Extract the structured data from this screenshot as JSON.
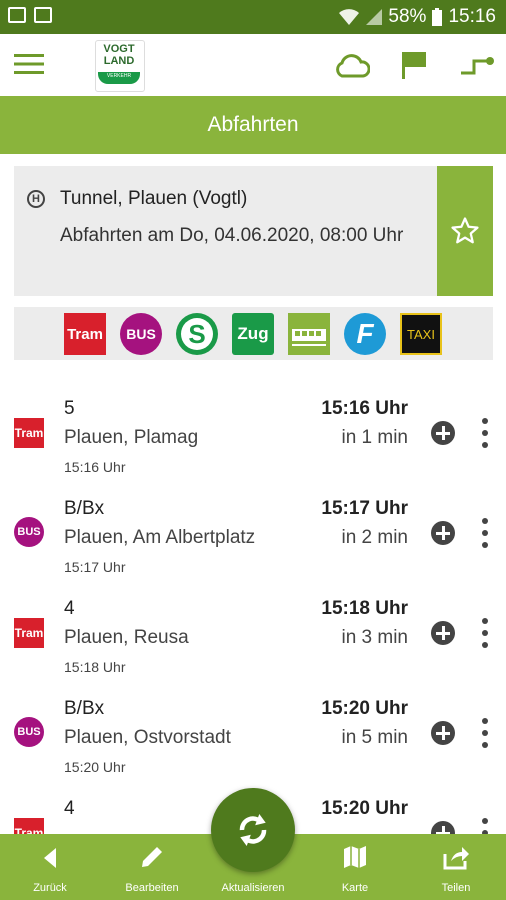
{
  "status_bar": {
    "battery": "58%",
    "time": "15:16"
  },
  "toolbar": {
    "logo_text_line1": "VOGT",
    "logo_text_line2": "LAND",
    "logo_text_line3": "VERKEHR"
  },
  "title": "Abfahrten",
  "station": {
    "name": "Tunnel, Plauen (Vogtl)",
    "departures_at": "Abfahrten am Do, 04.06.2020, 08:00 Uhr",
    "stop_icon_label": "H"
  },
  "modes": [
    {
      "name": "tram",
      "label": "Tram",
      "color": "#d8202c"
    },
    {
      "name": "bus",
      "label": "BUS",
      "color": "#a5127f"
    },
    {
      "name": "sbahn",
      "label": "S",
      "color": "#1a9a48"
    },
    {
      "name": "zug",
      "label": "Zug",
      "color": "#1a9a48"
    },
    {
      "name": "railcar",
      "label": "",
      "color": "#8ab43c"
    },
    {
      "name": "ferry",
      "label": "F",
      "color": "#1e9ad6"
    },
    {
      "name": "taxi",
      "label": "TAXI",
      "color": "#111111"
    }
  ],
  "departures": [
    {
      "mode": "Tram",
      "line": "5",
      "destination": "Plauen, Plamag",
      "scheduled": "15:16 Uhr",
      "time": "15:16 Uhr",
      "relative": "in 1 min"
    },
    {
      "mode": "BUS",
      "line": "B/Bx",
      "destination": "Plauen, Am Albertplatz",
      "scheduled": "15:17 Uhr",
      "time": "15:17 Uhr",
      "relative": "in 2 min"
    },
    {
      "mode": "Tram",
      "line": "4",
      "destination": "Plauen, Reusa",
      "scheduled": "15:18 Uhr",
      "time": "15:18 Uhr",
      "relative": "in 3 min"
    },
    {
      "mode": "BUS",
      "line": "B/Bx",
      "destination": "Plauen, Ostvorstadt",
      "scheduled": "15:20 Uhr",
      "time": "15:20 Uhr",
      "relative": "in 5 min"
    },
    {
      "mode": "Tram",
      "line": "4",
      "destination": "",
      "scheduled": "",
      "time": "15:20 Uhr",
      "relative": ""
    }
  ],
  "bottom_nav": {
    "back": "Zurück",
    "edit": "Bearbeiten",
    "refresh": "Aktualisieren",
    "map": "Karte",
    "share": "Teilen"
  },
  "colors": {
    "primary_green": "#8ab43c",
    "dark_green": "#4f7a1d"
  }
}
